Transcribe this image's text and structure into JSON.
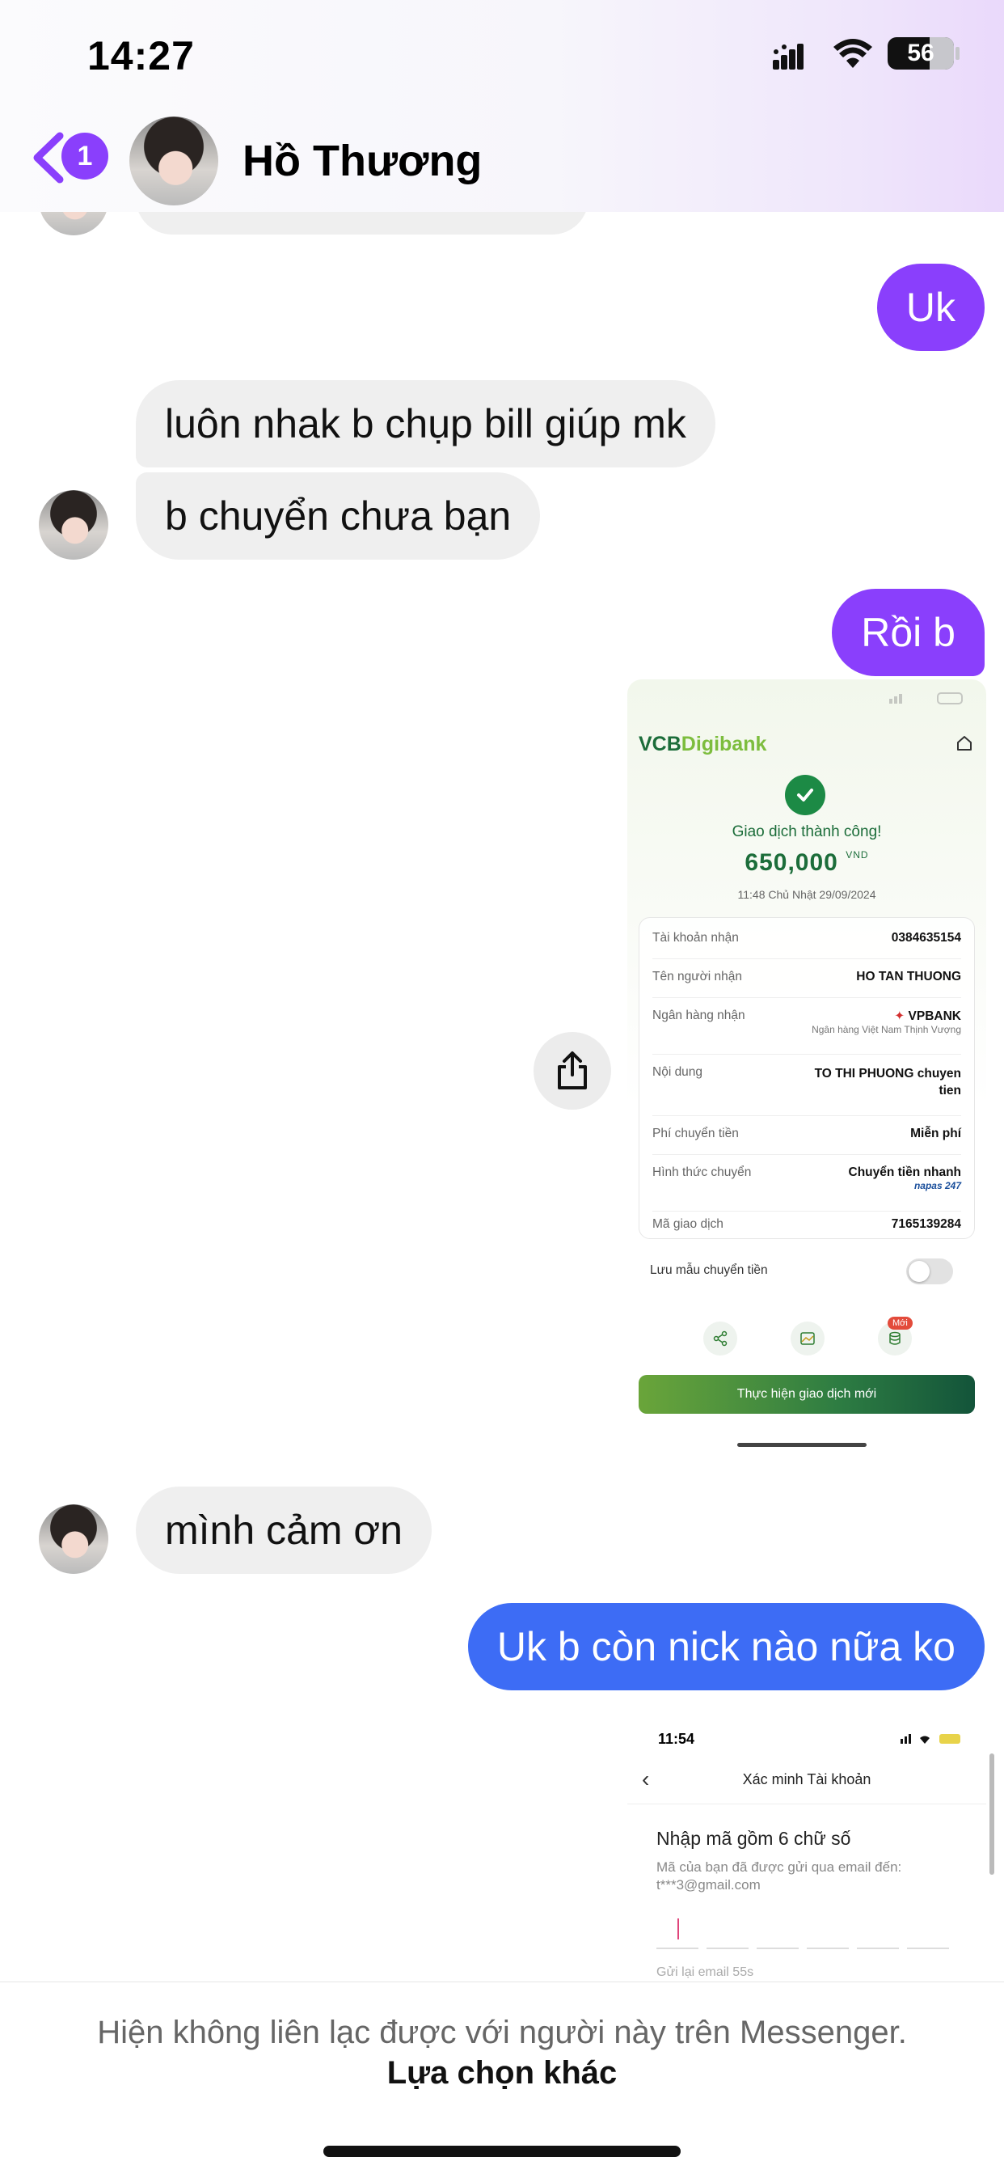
{
  "status_bar": {
    "time": "14:27",
    "battery": "56"
  },
  "header": {
    "unread_count": "1",
    "contact_name": "Hồ Thương"
  },
  "messages": [
    {
      "side": "sent",
      "text": "Uk"
    },
    {
      "side": "received",
      "text": "luôn nhak b chụp bill giúp mk"
    },
    {
      "side": "received",
      "text": "b chuyển chưa bạn"
    },
    {
      "side": "sent",
      "text": "Rồi b"
    },
    {
      "side": "received",
      "text": "mình cảm ơn"
    },
    {
      "side": "sent",
      "text": "Uk b còn nick nào nữa ko"
    }
  ],
  "receipt_image": {
    "logo_main": "VCB",
    "logo_sub": "Digibank",
    "status": "Giao dịch thành công!",
    "amount": "650,000",
    "currency": "VND",
    "datetime": "11:48 Chủ Nhật 29/09/2024",
    "rows": [
      {
        "label": "Tài khoản nhận",
        "value": "0384635154"
      },
      {
        "label": "Tên người nhận",
        "value": "HO TAN THUONG"
      },
      {
        "label": "Ngân hàng nhận",
        "value": "VPBANK",
        "sub": "Ngân hàng Việt Nam Thịnh Vượng"
      },
      {
        "label": "Nội dung",
        "value": "TO THI PHUONG chuyen tien"
      },
      {
        "label": "Phí chuyển tiền",
        "value": "Miễn phí"
      },
      {
        "label": "Hình thức chuyển",
        "value": "Chuyển tiền nhanh",
        "sub": "napas 247"
      },
      {
        "label": "Mã giao dịch",
        "value": "7165139284"
      }
    ],
    "save_template": "Lưu mẫu chuyển tiền",
    "new_badge": "Mới",
    "new_transaction_button": "Thực hiện giao dịch mới"
  },
  "verify_image": {
    "time": "11:54",
    "title": "Xác minh Tài khoản",
    "heading": "Nhập mã gồm 6 chữ số",
    "description": "Mã của bạn đã được gửi qua email đến: t***3@gmail.com",
    "resend": "Gửi lại email   55s"
  },
  "footer": {
    "notice": "Hiện không liên lạc được với người này trên Messenger.",
    "other_options": "Lựa chọn khác"
  },
  "colors": {
    "sent_bubble": "#8a3ffc",
    "sent_bubble_latest": "#3d6cf5",
    "received_bubble": "#efefef"
  }
}
